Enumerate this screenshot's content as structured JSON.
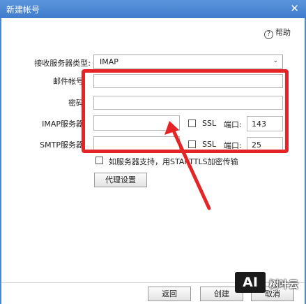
{
  "window": {
    "title": "新建帐号",
    "close_glyph": "✕"
  },
  "help": {
    "icon": "question-circle-icon",
    "label": "帮助"
  },
  "form": {
    "server_type_label": "接收服务器类型:",
    "server_type_value": "IMAP",
    "account_label": "邮件帐号",
    "password_label": "密码",
    "imap_label": "IMAP服务器",
    "smtp_label": "SMTP服务器",
    "ssl_label": "SSL",
    "port_label": "端口:",
    "imap_port": "143",
    "smtp_port": "25",
    "starttls_label": "如服务器支持，用STARTTLS加密传输",
    "proxy_button": "代理设置"
  },
  "footer": {
    "back_button": "返回",
    "create_button": "创建",
    "cancel_button": "取消"
  },
  "watermark": {
    "logo": "AI",
    "name": "树叶云"
  },
  "colors": {
    "title_bar": "#3f7ccc",
    "annotation_red": "#e52525"
  }
}
